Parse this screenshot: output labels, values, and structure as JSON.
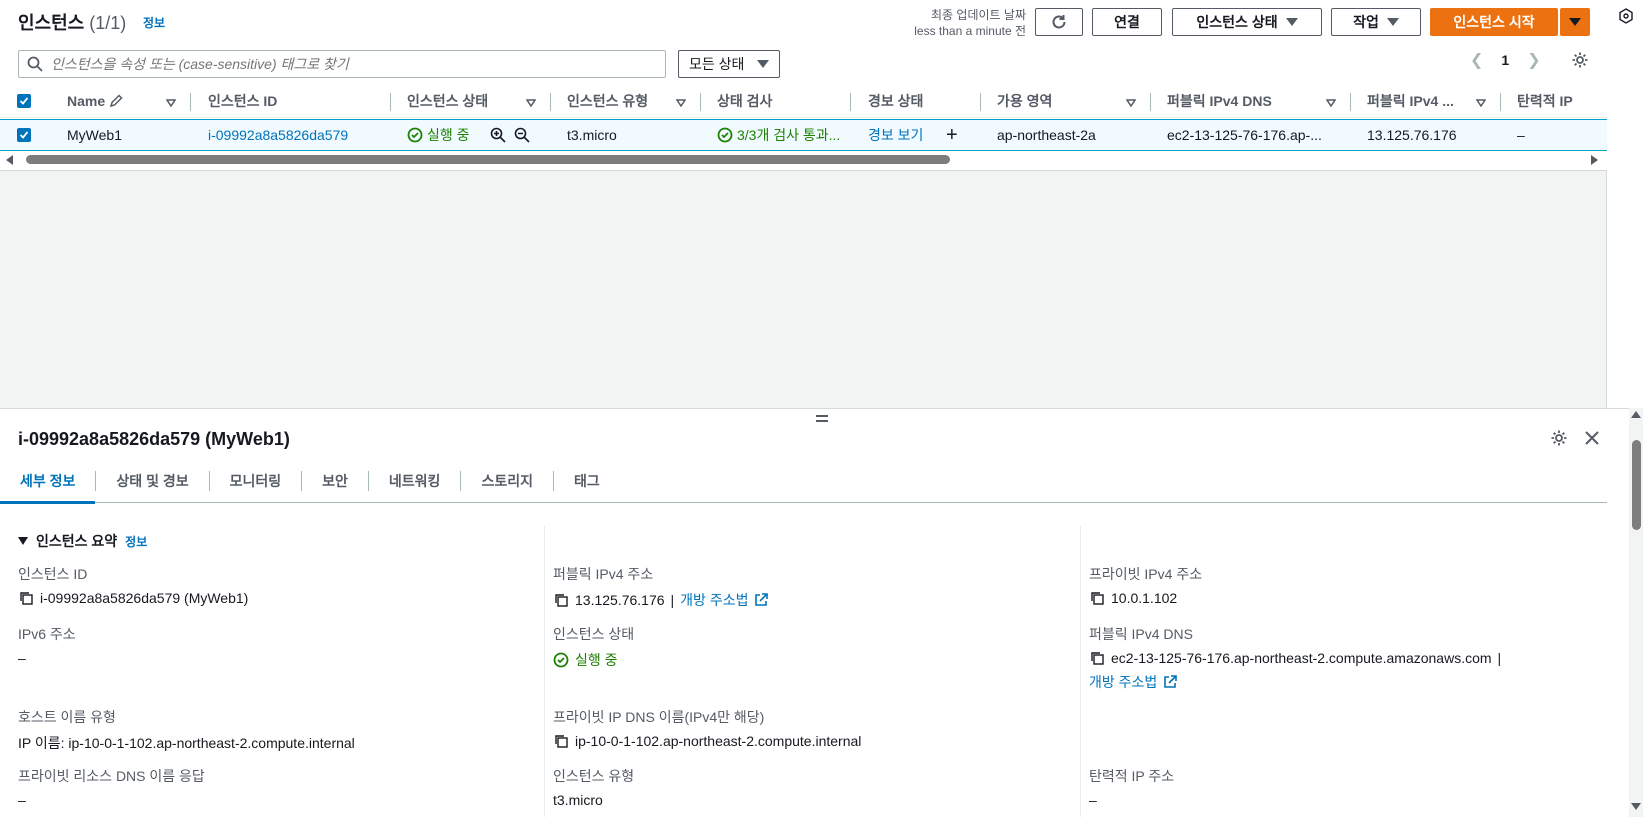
{
  "header": {
    "title": "인스턴스",
    "count": "(1/1)",
    "info": "정보",
    "last_updated_label": "최종 업데이트 날짜",
    "last_updated_value": "less than a minute 전",
    "buttons": {
      "refresh_icon": "refresh-icon",
      "connect": "연결",
      "instance_state": "인스턴스 상태",
      "actions": "작업",
      "launch": "인스턴스 시작"
    }
  },
  "filter": {
    "search_placeholder": "인스턴스을 속성 또는 (case-sensitive) 태그로 찾기",
    "state_select": "모든 상태"
  },
  "pagination": {
    "current_page": "1"
  },
  "table": {
    "columns": [
      "Name",
      "인스턴스 ID",
      "인스턴스 상태",
      "인스턴스 유형",
      "상태 검사",
      "경보 상태",
      "가용 영역",
      "퍼블릭 IPv4 DNS",
      "퍼블릭 IPv4 ...",
      "탄력적 IP"
    ],
    "row": {
      "name": "MyWeb1",
      "instance_id": "i-09992a8a5826da579",
      "state": "실행 중",
      "type": "t3.micro",
      "status_check": "3/3개 검사 통과...",
      "alarm": "경보 보기",
      "az": "ap-northeast-2a",
      "public_dns": "ec2-13-125-76-176.ap-...",
      "public_ip": "13.125.76.176",
      "elastic_ip": "–"
    }
  },
  "detail": {
    "title": "i-09992a8a5826da579 (MyWeb1)",
    "tabs": [
      "세부 정보",
      "상태 및 경보",
      "모니터링",
      "보안",
      "네트워킹",
      "스토리지",
      "태그"
    ],
    "summary_title": "인스턴스 요약",
    "summary_info": "정보",
    "fields": {
      "instance_id_label": "인스턴스 ID",
      "instance_id_value": "i-09992a8a5826da579 (MyWeb1)",
      "public_ipv4_label": "퍼블릭 IPv4 주소",
      "public_ipv4_value": "13.125.76.176",
      "public_ipv4_link": "개방 주소법",
      "private_ipv4_label": "프라이빗 IPv4 주소",
      "private_ipv4_value": "10.0.1.102",
      "ipv6_label": "IPv6 주소",
      "ipv6_value": "–",
      "state_label": "인스턴스 상태",
      "state_value": "실행 중",
      "public_dns_label": "퍼블릭 IPv4 DNS",
      "public_dns_value": "ec2-13-125-76-176.ap-northeast-2.compute.amazonaws.com",
      "public_dns_link": "개방 주소법",
      "hostname_type_label": "호스트 이름 유형",
      "hostname_type_value": "IP 이름: ip-10-0-1-102.ap-northeast-2.compute.internal",
      "private_dns_label": "프라이빗 IP DNS 이름(IPv4만 해당)",
      "private_dns_value": "ip-10-0-1-102.ap-northeast-2.compute.internal",
      "resource_dns_label": "프라이빗 리소스 DNS 이름 응답",
      "resource_dns_value": "–",
      "type_label": "인스턴스 유형",
      "type_value": "t3.micro",
      "elastic_ip_label": "탄력적 IP 주소",
      "elastic_ip_value": "–"
    }
  },
  "colors": {
    "accent": "#0073bb",
    "primary_button": "#ec7211",
    "success": "#1d8102",
    "selected_row": "#f1faff"
  }
}
